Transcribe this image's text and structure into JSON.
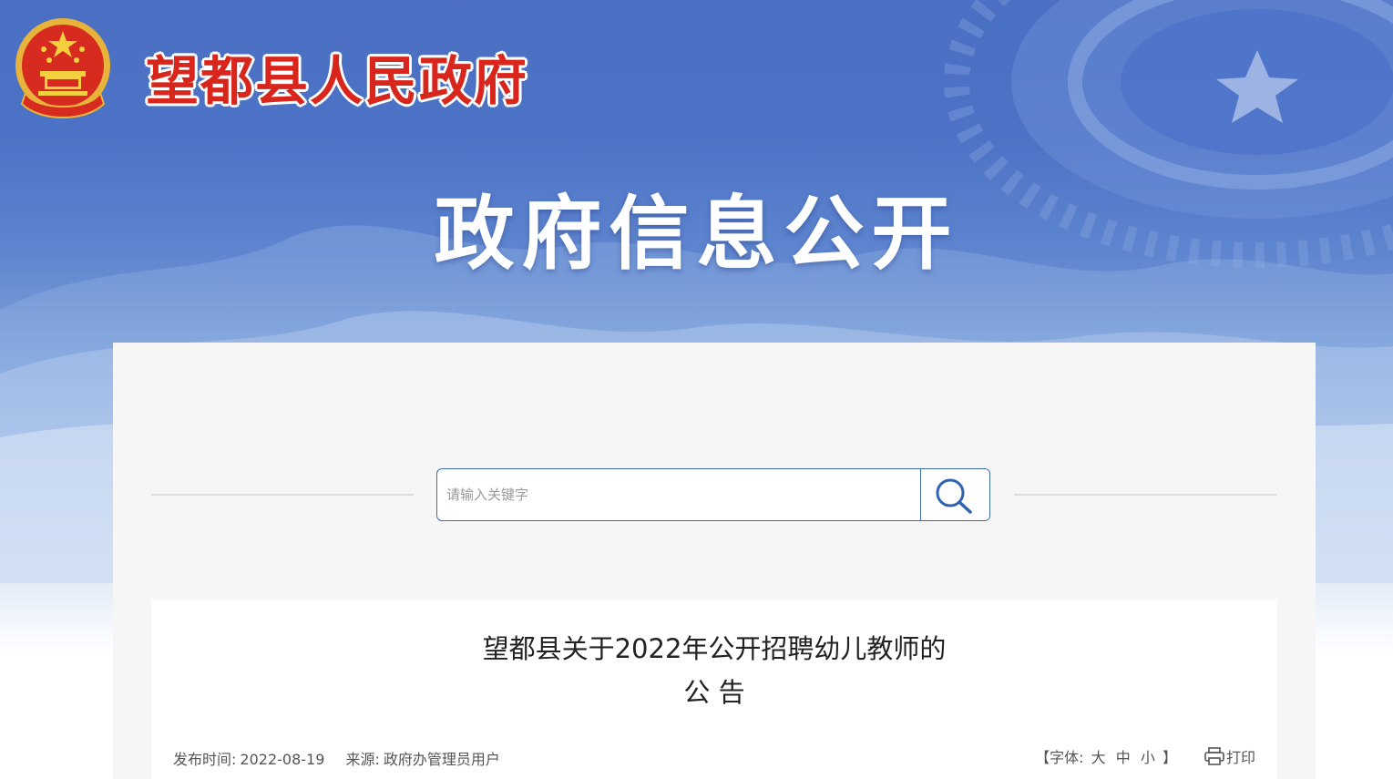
{
  "header": {
    "site_title": "望都县人民政府",
    "banner_title": "政府信息公开",
    "emblem_icon": "national-emblem-icon"
  },
  "search": {
    "placeholder": "请输入关键字",
    "value": "",
    "button_icon": "search-icon"
  },
  "article": {
    "title_line1": "望都县关于2022年公开招聘幼儿教师的",
    "title_line2": "公 告",
    "publish_label": "发布时间:",
    "publish_date": "2022-08-19",
    "source_label": "来源:",
    "source_value": "政府办管理员用户",
    "font_open": "【字体:",
    "font_large": "大",
    "font_medium": "中",
    "font_small": "小",
    "font_close": "】",
    "print_label": "打印",
    "print_icon": "printer-icon"
  },
  "colors": {
    "header_blue": "#4a6fc3",
    "title_red": "#d8261d",
    "search_border": "#3c6cb4",
    "panel_bg": "#f6f6f6"
  }
}
